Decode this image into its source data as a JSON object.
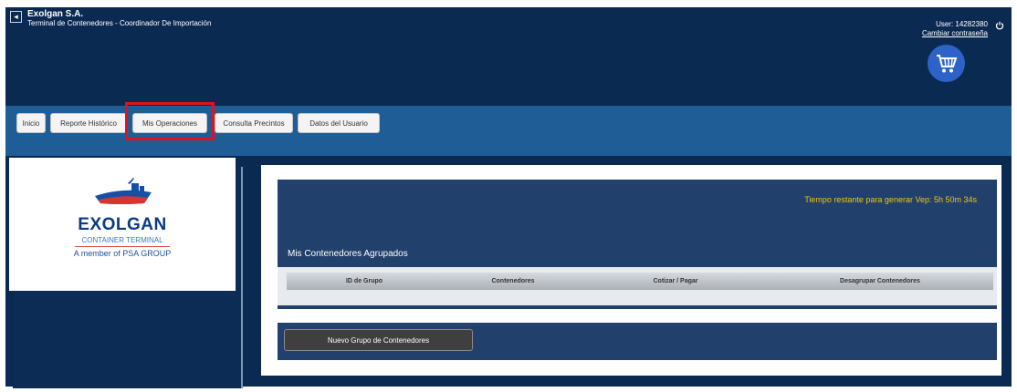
{
  "header": {
    "company": "Exolgan S.A.",
    "subtitle": "Terminal de Contenedores - Coordinador De Importación",
    "user_label": "User: 14282380",
    "change_password": "Cambiar contraseña"
  },
  "icons": {
    "back": "back-arrow-icon",
    "power": "power-icon",
    "cart": "shopping-cart-icon"
  },
  "nav": {
    "tabs": [
      {
        "label": "Inicio"
      },
      {
        "label": "Reporte Histórico"
      },
      {
        "label": "Mis Operaciones"
      },
      {
        "label": "Consulta Precintos"
      },
      {
        "label": "Datos del Usuario"
      }
    ],
    "highlighted_tab": "Mis Operaciones"
  },
  "logo": {
    "title": "EXOLGAN",
    "subtitle": "CONTAINER TERMINAL",
    "tagline": "A member of PSA GROUP"
  },
  "main": {
    "timer": "Tiempo restante para generar Vep: 5h 50m 34s",
    "section_title": "Mis Contenedores Agrupados",
    "table_columns": [
      "ID de Grupo",
      "Contenedores",
      "Cotizar / Pagar",
      "Desagrupar Contenedores"
    ],
    "new_group_button": "Nuevo Grupo de Contenedores"
  },
  "colors": {
    "header_bg": "#0b2a52",
    "nav_bg": "#1e5d96",
    "highlight": "#e0121d",
    "timer": "#f0c419",
    "cart_bg": "#2d63c9"
  }
}
